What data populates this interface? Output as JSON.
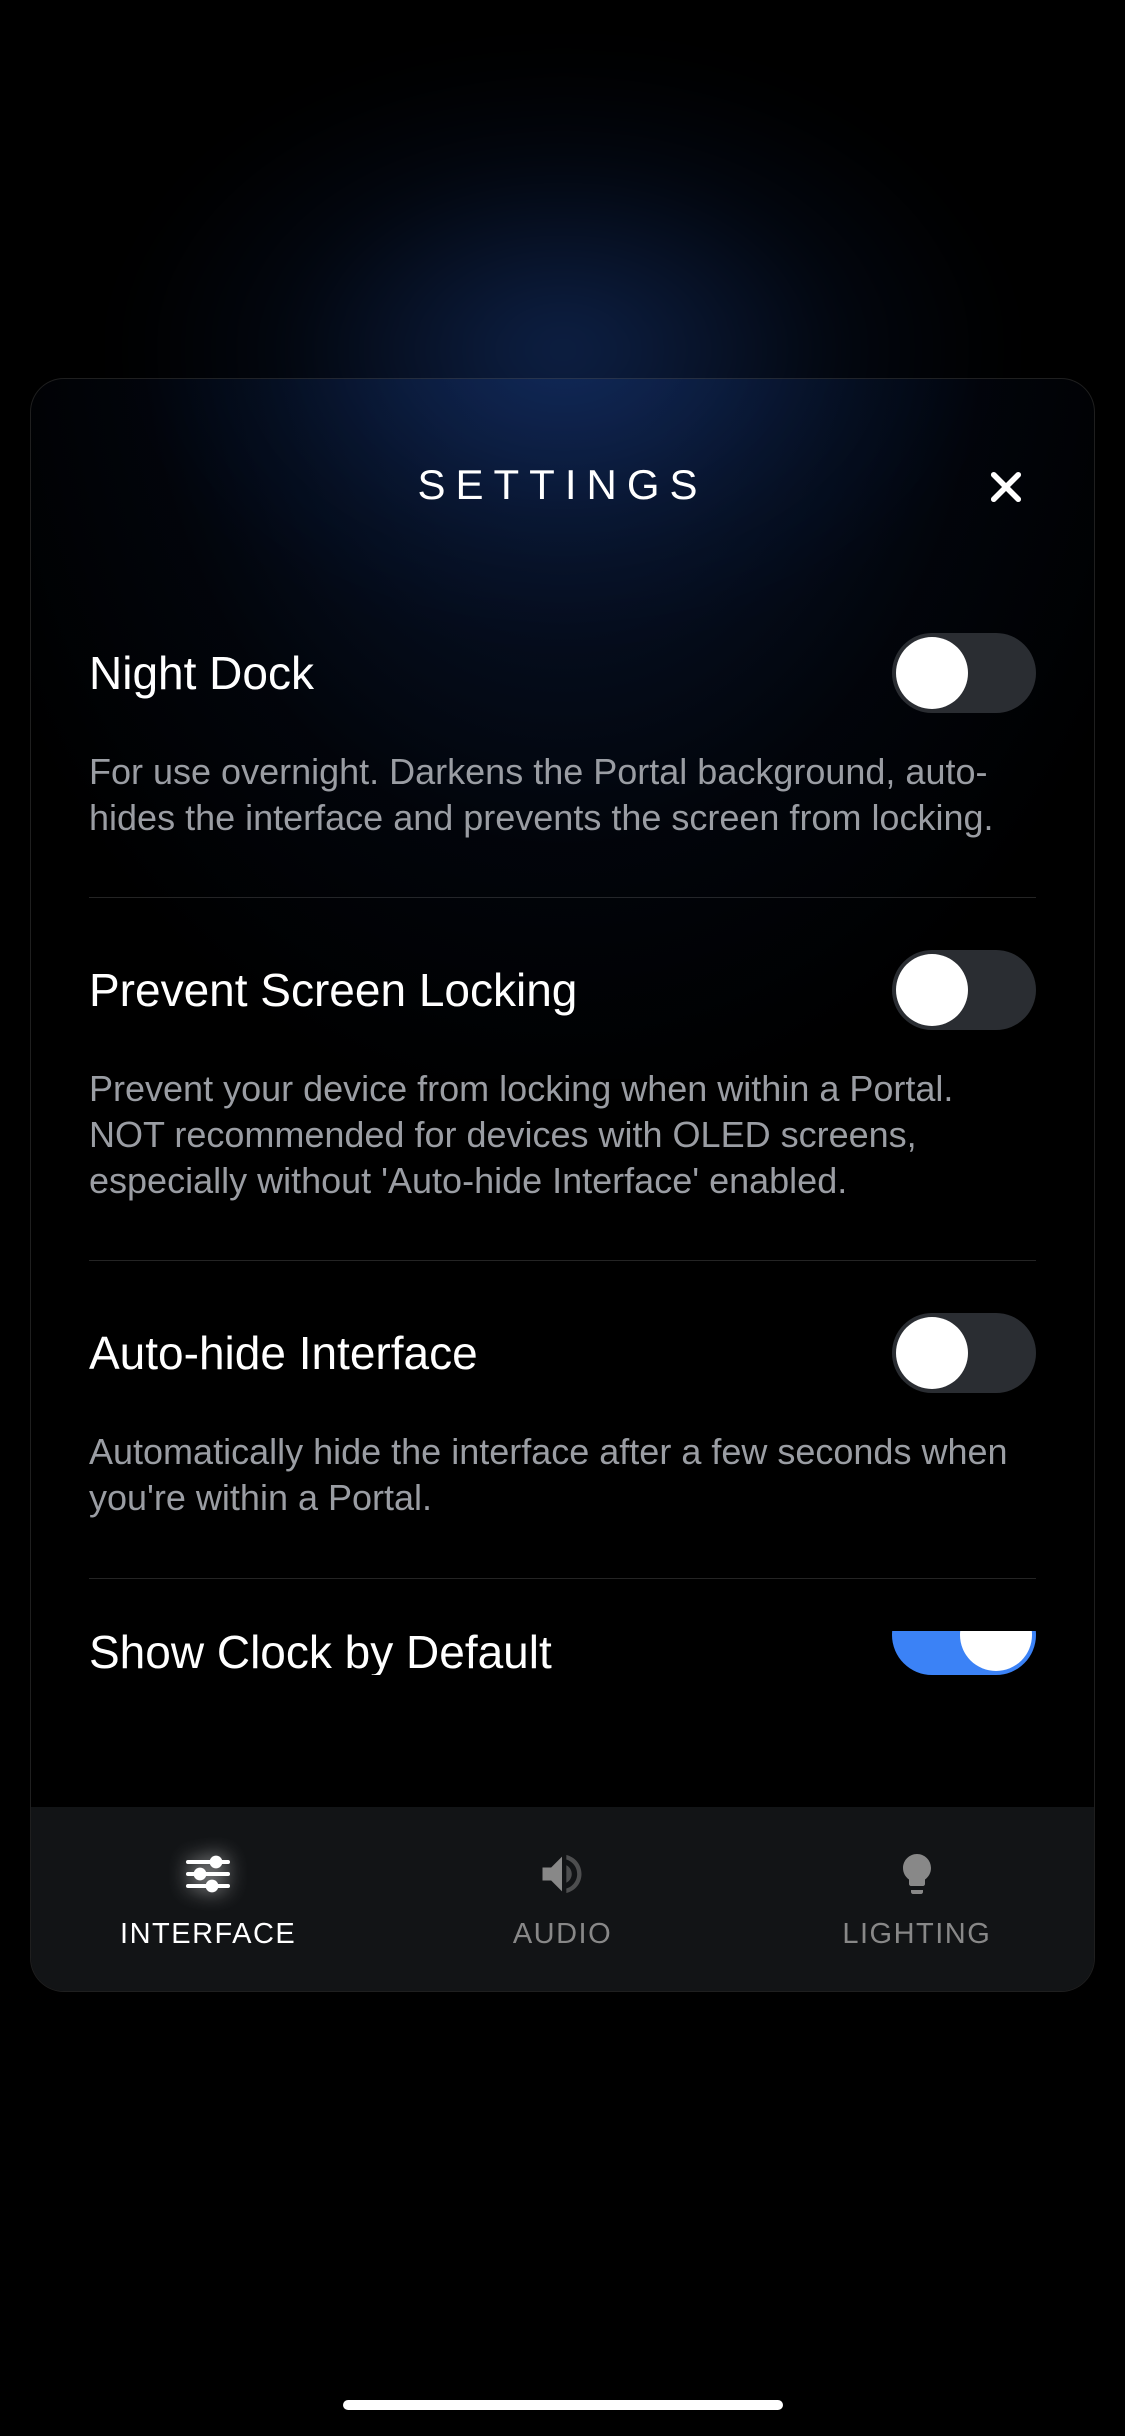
{
  "header": {
    "title": "SETTINGS"
  },
  "settings": [
    {
      "title": "Night Dock",
      "description": "For use overnight. Darkens the Portal background, auto-hides the interface and prevents the screen from locking.",
      "enabled": false
    },
    {
      "title": "Prevent Screen Locking",
      "description": "Prevent your device from locking when within a Portal. NOT recommended for devices with OLED screens, especially without 'Auto-hide Interface' enabled.",
      "enabled": false
    },
    {
      "title": "Auto-hide Interface",
      "description": "Automatically hide the interface after a few seconds when you're within a Portal.",
      "enabled": false
    },
    {
      "title": "Show Clock by Default",
      "description": "",
      "enabled": true
    }
  ],
  "tabs": [
    {
      "label": "INTERFACE",
      "active": true
    },
    {
      "label": "AUDIO",
      "active": false
    },
    {
      "label": "LIGHTING",
      "active": false
    }
  ]
}
